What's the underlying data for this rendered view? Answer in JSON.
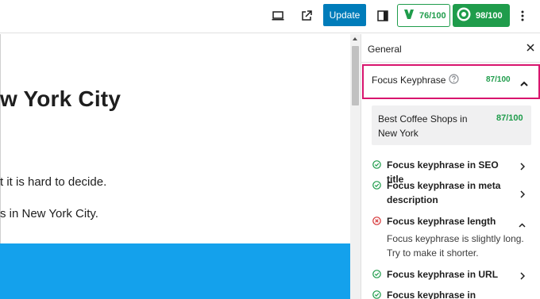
{
  "toolbar": {
    "update_label": "Update",
    "readability_score": "76/100",
    "seo_score": "98/100",
    "colors": {
      "primary": "#007cba",
      "good": "#1f9c4b"
    }
  },
  "editor": {
    "title": "w York City",
    "paragraph1": "t it is hard to decide.",
    "paragraph2": "s in New York City.",
    "image_color": "#14a1ec"
  },
  "sidebar": {
    "header": "General",
    "focus_keyphrase": {
      "label": "Focus Keyphrase",
      "score": "87/100",
      "highlight_color": "#d8156e"
    },
    "keyphrase": {
      "value": "Best Coffee Shops in New York",
      "score": "87/100"
    },
    "checks": [
      {
        "label": "Focus keyphrase in SEO title",
        "status": "good"
      },
      {
        "label": "Focus keyphrase in meta description",
        "status": "good"
      },
      {
        "label": "Focus keyphrase length",
        "status": "bad",
        "description": "Focus keyphrase is slightly long. Try to make it shorter."
      },
      {
        "label": "Focus keyphrase in URL",
        "status": "good"
      },
      {
        "label": "Focus keyphrase in",
        "status": "good"
      }
    ]
  }
}
